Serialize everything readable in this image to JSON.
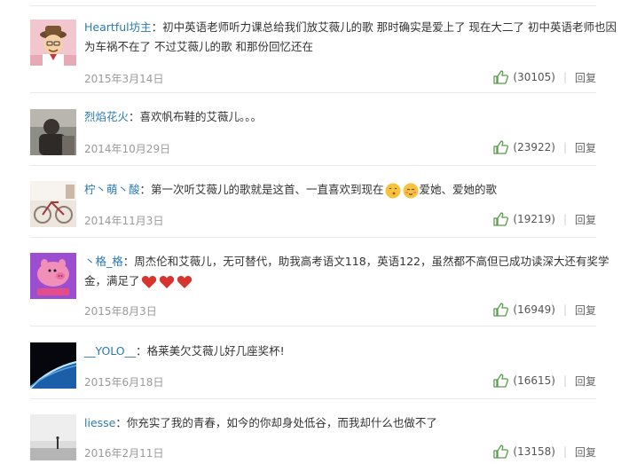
{
  "comments": [
    {
      "username": "Heartful坊主",
      "line1": "初中英语老师听力课总给我们放艾薇儿的歌 那时确实是爱上了 现在大二了 初中英语老师也因",
      "line2": "为车祸不在了 不过艾薇儿的歌 和那份回忆还在",
      "date": "2015年3月14日",
      "likes": "(30105)",
      "reply": "回复",
      "avatar_icon": "cartoon-man-avatar"
    },
    {
      "username": "烈焰花火",
      "line1": "喜欢帆布鞋的艾薇儿。。。",
      "date": "2014年10月29日",
      "likes": "(23922)",
      "reply": "回复",
      "avatar_icon": "photo-person-avatar"
    },
    {
      "username": "柠丶萌丶酸",
      "line1": "第一次听艾薇儿的歌就是这首、一直喜欢到现在",
      "line1_tail": "爱她、爱她的歌",
      "date": "2014年11月3日",
      "likes": "(19219)",
      "reply": "回复",
      "avatar_icon": "bicycle-photo-avatar",
      "emojis": [
        "kiss-emoji",
        "blush-emoji"
      ]
    },
    {
      "username": "丶格_格",
      "line1": "周杰伦和艾薇儿，无可替代，助我高考语文118，英语122，虽然都不高但已成功读深大还有奖学",
      "line2": "金，满足了",
      "date": "2015年8月3日",
      "likes": "(16949)",
      "reply": "回复",
      "avatar_icon": "pink-pig-avatar",
      "emojis": [
        "heart-emoji",
        "heart-emoji",
        "heart-emoji"
      ]
    },
    {
      "username": "__YOLO__",
      "line1": "格莱美欠艾薇儿好几座奖杯!",
      "date": "2015年6月18日",
      "likes": "(16615)",
      "reply": "回复",
      "avatar_icon": "earth-horizon-avatar"
    },
    {
      "username": "liesse",
      "line1": "你充实了我的青春，如今的你却身处低谷，而我却什么也做不了",
      "date": "2016年2月11日",
      "likes": "(13158)",
      "reply": "回复",
      "avatar_icon": "silhouette-landscape-avatar"
    }
  ],
  "colors": {
    "username": "#2a7ab0",
    "text": "#333333",
    "date": "#9a9a9a",
    "like_icon": "#5a9a4a",
    "divider": "#e9e9e9"
  }
}
